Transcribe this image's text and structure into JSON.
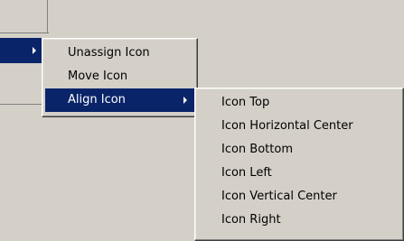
{
  "menu": {
    "items": [
      {
        "label": "Unassign Icon",
        "has_submenu": false,
        "highlighted": false
      },
      {
        "label": "Move Icon",
        "has_submenu": false,
        "highlighted": false
      },
      {
        "label": "Align Icon",
        "has_submenu": true,
        "highlighted": true
      }
    ]
  },
  "submenu": {
    "items": [
      {
        "label": "Icon Top"
      },
      {
        "label": "Icon Horizontal Center"
      },
      {
        "label": "Icon Bottom"
      },
      {
        "label": "Icon Left"
      },
      {
        "label": "Icon Vertical Center"
      },
      {
        "label": "Icon Right"
      }
    ]
  },
  "colors": {
    "background": "#d4d0c8",
    "highlight": "#0a246a",
    "highlight_text": "#ffffff"
  }
}
